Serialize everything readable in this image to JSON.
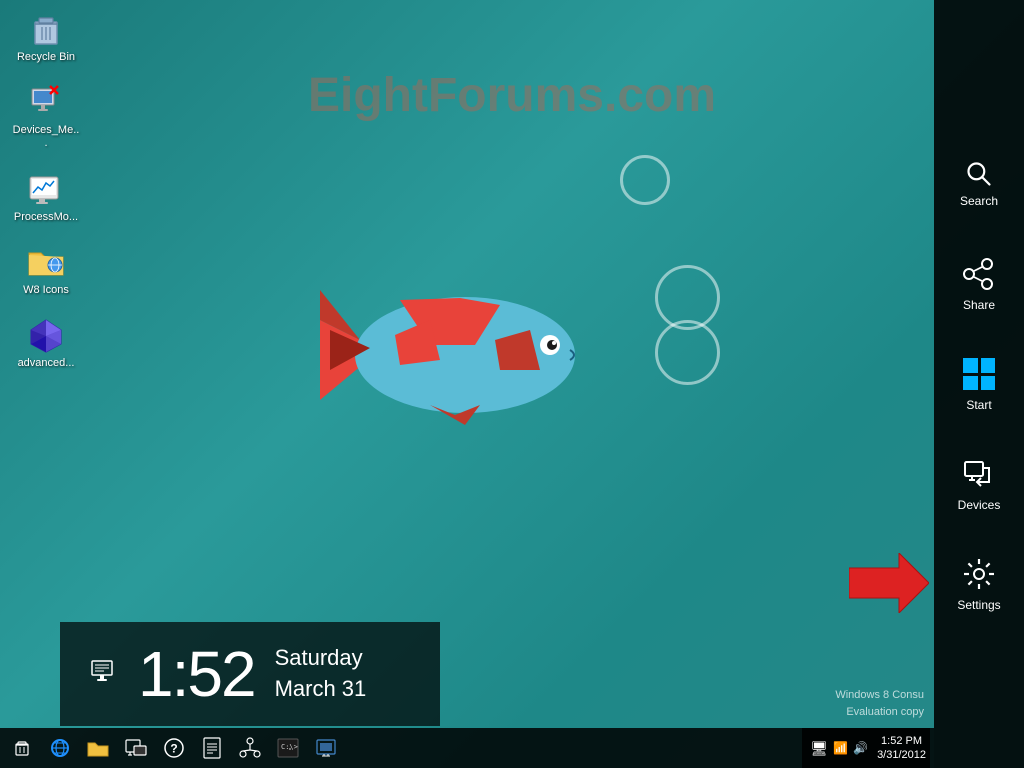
{
  "watermark": {
    "text": "EightForums.com"
  },
  "desktop_icons": [
    {
      "id": "recycle-bin",
      "label": "Recycle Bin",
      "icon_type": "recycle"
    },
    {
      "id": "devices-me",
      "label": "Devices_Me...",
      "icon_type": "devices_file"
    },
    {
      "id": "process-monitor",
      "label": "ProcessMo...",
      "icon_type": "process"
    },
    {
      "id": "w8-icons",
      "label": "W8 Icons",
      "icon_type": "folder"
    },
    {
      "id": "advanced",
      "label": "advanced...",
      "icon_type": "advanced"
    }
  ],
  "clock": {
    "time": "1:52",
    "day": "Saturday",
    "date": "March 31"
  },
  "windows_watermark": {
    "line1": "Windows 8 Consu",
    "line2": "Evaluation copy"
  },
  "charms": [
    {
      "id": "search",
      "label": "Search"
    },
    {
      "id": "share",
      "label": "Share"
    },
    {
      "id": "start",
      "label": "Start"
    },
    {
      "id": "devices",
      "label": "Devices"
    },
    {
      "id": "settings",
      "label": "Settings"
    }
  ],
  "taskbar": {
    "items": [
      {
        "id": "recycle",
        "label": "Recycle"
      },
      {
        "id": "ie",
        "label": "Internet Explorer"
      },
      {
        "id": "explorer",
        "label": "File Explorer"
      },
      {
        "id": "remote",
        "label": "Remote"
      },
      {
        "id": "help",
        "label": "Help"
      },
      {
        "id": "notepad",
        "label": "Notepad"
      },
      {
        "id": "network",
        "label": "Network"
      },
      {
        "id": "cmd",
        "label": "Command Prompt"
      },
      {
        "id": "rdp",
        "label": "Remote Desktop"
      }
    ]
  },
  "colors": {
    "charms_bg": "#141414",
    "taskbar_bg": "#1a1a1a",
    "accent_blue": "#00b4ff",
    "settings_highlight": "#ffffff"
  }
}
